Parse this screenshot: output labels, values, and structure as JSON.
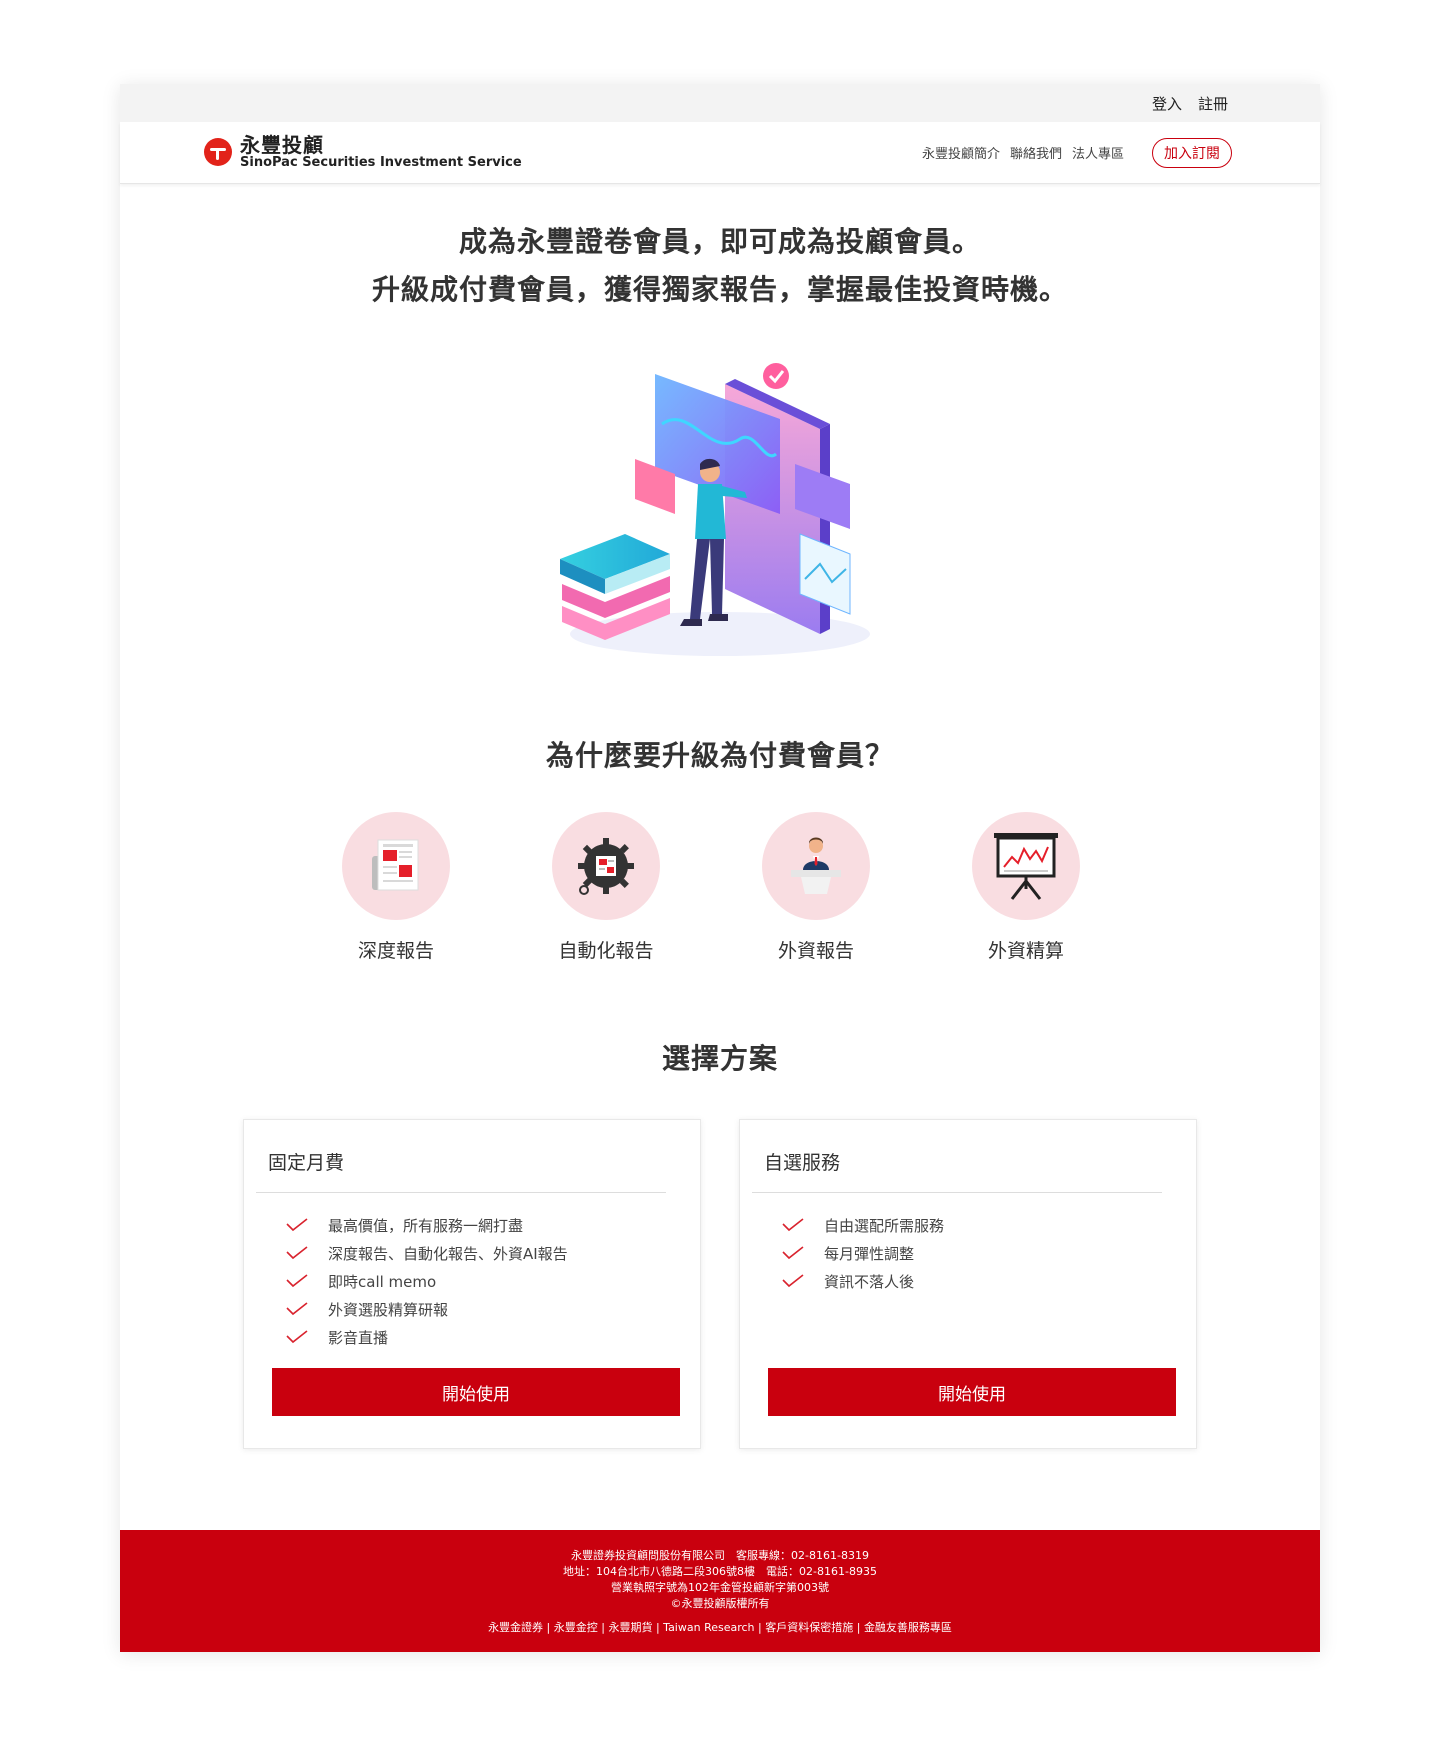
{
  "utility_bar": {
    "login": "登入",
    "register": "註冊"
  },
  "brand": {
    "name_zh": "永豐投顧",
    "name_en": "SinoPac Securities Investment Service"
  },
  "nav": {
    "links": [
      "永豐投顧簡介",
      "聯絡我們",
      "法人專區"
    ],
    "subscribe": "加入訂閱"
  },
  "hero": {
    "line1": "成為永豐證卷會員，即可成為投顧會員。",
    "line2": "升級成付費會員，獲得獨家報告，掌握最佳投資時機。"
  },
  "why": {
    "title": "為什麼要升級為付費會員？",
    "features": [
      {
        "label": "深度報告",
        "icon": "newspaper-icon"
      },
      {
        "label": "自動化報告",
        "icon": "gear-report-icon"
      },
      {
        "label": "外資報告",
        "icon": "presenter-icon"
      },
      {
        "label": "外資精算",
        "icon": "chart-board-icon"
      }
    ]
  },
  "plans": {
    "title": "選擇方案",
    "cards": [
      {
        "name": "固定月費",
        "features": [
          "最高價值，所有服務一網打盡",
          "深度報告、自動化報告、外資AI報告",
          "即時call memo",
          "外資選股精算研報",
          "影音直播"
        ],
        "button": "開始使用"
      },
      {
        "name": "自選服務",
        "features": [
          "自由選配所需服務",
          "每月彈性調整",
          "資訊不落人後"
        ],
        "button": "開始使用"
      }
    ]
  },
  "footer": {
    "line1": "永豐證券投資顧問股份有限公司　客服專線：02-8161-8319",
    "line2": "地址：104台北市八德路二段306號8樓　電話：02-8161-8935",
    "line3": "營業執照字號為102年金管投顧新字第003號",
    "line4": "©永豐投顧版權所有",
    "links": [
      "永豐金證券",
      "永豐金控",
      "永豐期貨",
      "Taiwan Research",
      "客戶資料保密措施",
      "金融友善服務專區"
    ],
    "separator": " | "
  },
  "colors": {
    "brand_red": "#c9000e",
    "feature_circle": "#f9dde1",
    "header_bar": "#f3f3f3"
  }
}
